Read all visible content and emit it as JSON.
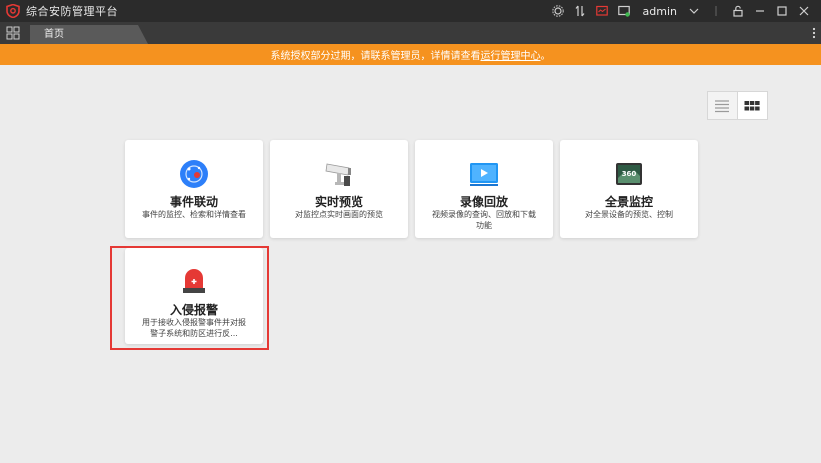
{
  "titlebar": {
    "title": "综合安防管理平台",
    "username": "admin"
  },
  "tabs": [
    {
      "label": "首页"
    }
  ],
  "notice": {
    "text": "系统授权部分过期，请联系管理员，详情请查看",
    "link_text": "运行管理中心",
    "suffix": "。"
  },
  "colors": {
    "notice_bg": "#f5921f",
    "titlebar_bg": "#2b2b2b",
    "highlight": "#e53935",
    "accent": "#d9232e"
  },
  "cards": [
    {
      "title": "事件联动",
      "desc": "事件的监控、检索和详情查看",
      "icon": "event-linkage-icon"
    },
    {
      "title": "实时预览",
      "desc": "对监控点实时画面的预览",
      "icon": "camera-icon"
    },
    {
      "title": "录像回放",
      "desc": "视频录像的查询、回放和下载功能",
      "icon": "video-playback-icon"
    },
    {
      "title": "全景监控",
      "desc": "对全景设备的预览、控制",
      "icon": "panorama-icon"
    },
    {
      "title": "入侵报警",
      "desc": "用于接收入侵报警事件并对报警子系统和防区进行反...",
      "icon": "alarm-icon"
    }
  ],
  "panorama_badge": "360"
}
